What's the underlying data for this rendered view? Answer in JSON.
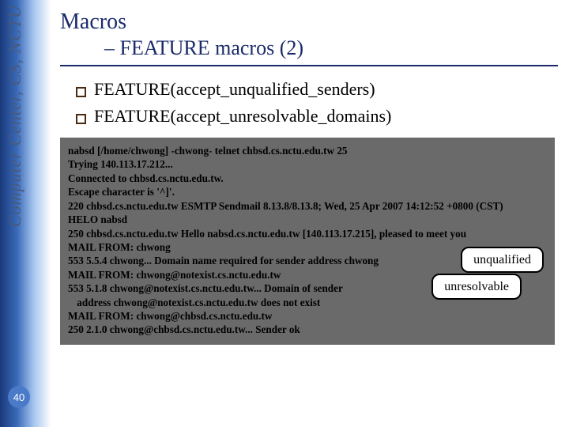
{
  "side_label": "Computer Center, CS, NCTU",
  "page_number": "40",
  "title": "Macros",
  "subtitle": "– FEATURE macros (2)",
  "bullets": [
    "FEATURE(accept_unqualified_senders)",
    "FEATURE(accept_unresolvable_domains)"
  ],
  "terminal": {
    "lines": [
      "nabsd [/home/chwong] -chwong- telnet chbsd.cs.nctu.edu.tw 25",
      "Trying 140.113.17.212...",
      "Connected to chbsd.cs.nctu.edu.tw.",
      "Escape character is '^]'.",
      "220 chbsd.cs.nctu.edu.tw ESMTP Sendmail 8.13.8/8.13.8; Wed, 25 Apr 2007 14:12:52 +0800 (CST)",
      "HELO nabsd",
      "250 chbsd.cs.nctu.edu.tw Hello nabsd.cs.nctu.edu.tw [140.113.17.215], pleased to meet you",
      "MAIL FROM: chwong",
      "553 5.5.4 chwong... Domain name required for sender address chwong",
      "MAIL FROM: chwong@notexist.cs.nctu.edu.tw",
      "553 5.1.8 chwong@notexist.cs.nctu.edu.tw... Domain of sender",
      " address chwong@notexist.cs.nctu.edu.tw does not exist",
      "MAIL FROM: chwong@chbsd.cs.nctu.edu.tw",
      "250 2.1.0 chwong@chbsd.cs.nctu.edu.tw... Sender ok"
    ]
  },
  "callouts": {
    "unqualified": "unqualified",
    "unresolvable": "unresolvable"
  }
}
